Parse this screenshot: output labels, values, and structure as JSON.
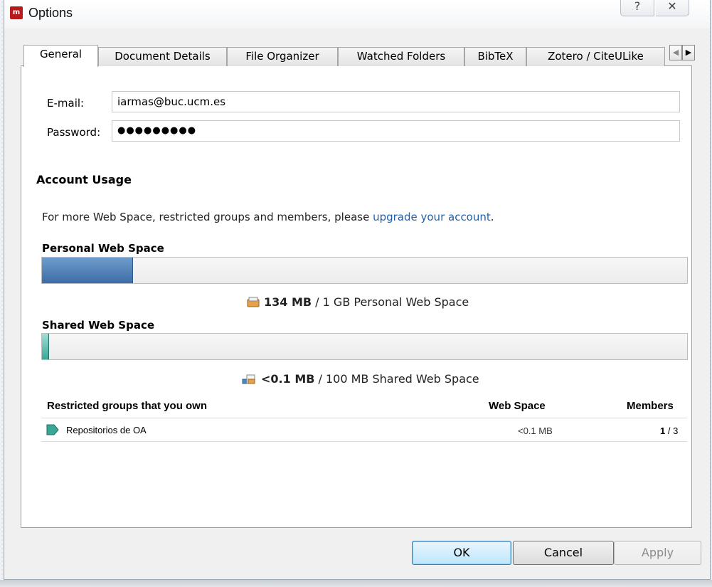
{
  "window": {
    "title": "Options",
    "help_glyph": "?",
    "close_glyph": "✕",
    "app_icon_text": "m"
  },
  "tabs": [
    {
      "label": "General",
      "active": true
    },
    {
      "label": "Document Details"
    },
    {
      "label": "File Organizer"
    },
    {
      "label": "Watched Folders"
    },
    {
      "label": "BibTeX"
    },
    {
      "label": "Zotero / CiteULike"
    }
  ],
  "tab_scroll": {
    "left": "◀",
    "right": "▶"
  },
  "account": {
    "email_label": "E-mail:",
    "email_value": "iarmas@buc.ucm.es",
    "password_label": "Password:",
    "password_value": "●●●●●●●●●"
  },
  "usage": {
    "section_title": "Account Usage",
    "info_text": "For more Web Space, restricted groups and members, please ",
    "info_link": "upgrade your account",
    "info_end": ".",
    "personal": {
      "title": "Personal Web Space",
      "fill_fraction": 0.14,
      "used": "134 MB",
      "rest": " / 1 GB Personal Web Space"
    },
    "shared": {
      "title": "Shared Web Space",
      "fill_fraction": 0.01,
      "used": "<0.1 MB",
      "rest": " / 100 MB Shared Web Space"
    }
  },
  "groups": {
    "headers": {
      "name": "Restricted groups that you own",
      "space": "Web Space",
      "members": "Members"
    },
    "rows": [
      {
        "name": "Repositorios de OA",
        "space": "<0.1 MB",
        "members_used": "1",
        "members_total": " / 3"
      }
    ]
  },
  "buttons": {
    "ok": "OK",
    "cancel": "Cancel",
    "apply": "Apply"
  },
  "colors": {
    "personal_bar": "#3c6da6",
    "shared_bar": "#3aa695",
    "link": "#1f5fad",
    "app_icon": "#b8191b"
  }
}
